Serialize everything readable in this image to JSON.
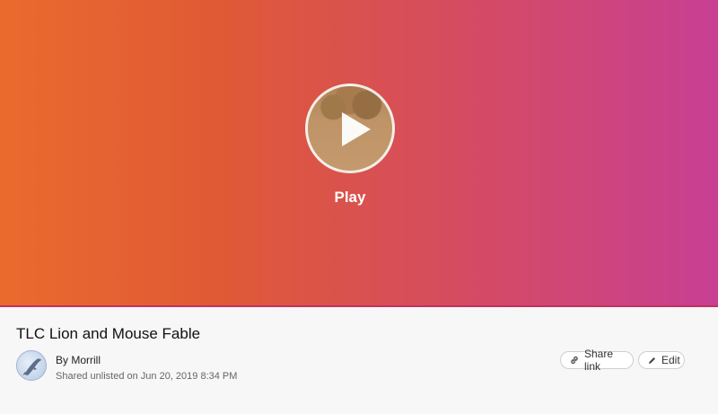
{
  "hero": {
    "play_label": "Play",
    "gradient_colors": [
      "#ea6a2e",
      "#e05a35",
      "#d64d5c",
      "#c83f93"
    ]
  },
  "video": {
    "title": "TLC Lion and Mouse Fable",
    "byline_prefix": "By ",
    "author": "Morrill",
    "shared_text": "Shared unlisted on Jun 20, 2019 8:34 PM"
  },
  "actions": {
    "share_label": "Share link",
    "edit_label": "Edit"
  },
  "icons": {
    "share": "link-icon",
    "edit": "pencil-icon",
    "play": "play-icon",
    "avatar": "dolphin-icon"
  }
}
